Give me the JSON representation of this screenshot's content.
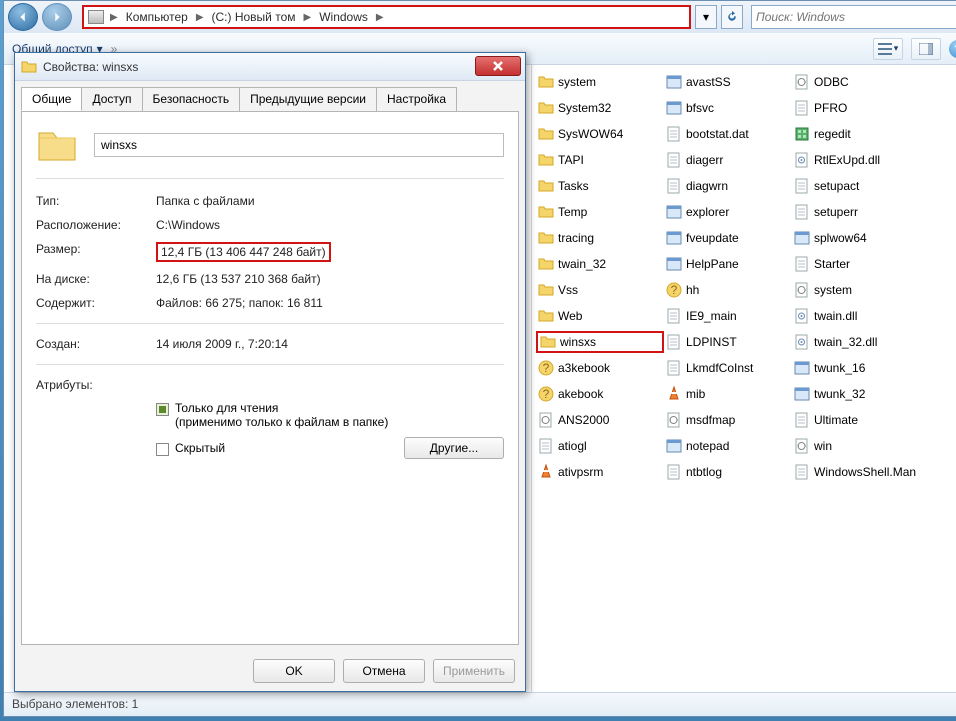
{
  "explorer": {
    "breadcrumbs": [
      "Компьютер",
      "(C:) Новый том",
      "Windows"
    ],
    "search_placeholder": "Поиск: Windows",
    "toolbar": {
      "share": "Общий доступ",
      "more": "»"
    },
    "statusbar": "Выбрано элементов: 1"
  },
  "files": {
    "col1": [
      {
        "n": "system",
        "t": "folder"
      },
      {
        "n": "System32",
        "t": "folder"
      },
      {
        "n": "SysWOW64",
        "t": "folder"
      },
      {
        "n": "TAPI",
        "t": "folder"
      },
      {
        "n": "Tasks",
        "t": "folder"
      },
      {
        "n": "Temp",
        "t": "folder"
      },
      {
        "n": "tracing",
        "t": "folder"
      },
      {
        "n": "twain_32",
        "t": "folder"
      },
      {
        "n": "Vss",
        "t": "folder"
      },
      {
        "n": "Web",
        "t": "folder"
      },
      {
        "n": "winsxs",
        "t": "folder",
        "hl": true
      },
      {
        "n": "a3kebook",
        "t": "hlp"
      },
      {
        "n": "akebook",
        "t": "hlp"
      },
      {
        "n": "ANS2000",
        "t": "cfg"
      },
      {
        "n": "atiogl",
        "t": "file"
      },
      {
        "n": "ativpsrm",
        "t": "vlc"
      }
    ],
    "col2": [
      {
        "n": "avastSS",
        "t": "app"
      },
      {
        "n": "bfsvc",
        "t": "app"
      },
      {
        "n": "bootstat.dat",
        "t": "file"
      },
      {
        "n": "diagerr",
        "t": "file"
      },
      {
        "n": "diagwrn",
        "t": "file"
      },
      {
        "n": "explorer",
        "t": "app"
      },
      {
        "n": "fveupdate",
        "t": "app"
      },
      {
        "n": "HelpPane",
        "t": "app"
      },
      {
        "n": "hh",
        "t": "hlp"
      },
      {
        "n": "IE9_main",
        "t": "file"
      },
      {
        "n": "LDPINST",
        "t": "file"
      },
      {
        "n": "LkmdfCoInst",
        "t": "file"
      },
      {
        "n": "mib",
        "t": "vlc"
      },
      {
        "n": "msdfmap",
        "t": "cfg"
      },
      {
        "n": "notepad",
        "t": "app"
      },
      {
        "n": "ntbtlog",
        "t": "file"
      }
    ],
    "col3": [
      {
        "n": "ODBC",
        "t": "cfg"
      },
      {
        "n": "PFRO",
        "t": "file"
      },
      {
        "n": "regedit",
        "t": "reg"
      },
      {
        "n": "RtlExUpd.dll",
        "t": "dll"
      },
      {
        "n": "setupact",
        "t": "file"
      },
      {
        "n": "setuperr",
        "t": "file"
      },
      {
        "n": "splwow64",
        "t": "app"
      },
      {
        "n": "Starter",
        "t": "file"
      },
      {
        "n": "system",
        "t": "cfg"
      },
      {
        "n": "twain.dll",
        "t": "dll"
      },
      {
        "n": "twain_32.dll",
        "t": "dll"
      },
      {
        "n": "twunk_16",
        "t": "app"
      },
      {
        "n": "twunk_32",
        "t": "app"
      },
      {
        "n": "Ultimate",
        "t": "file"
      },
      {
        "n": "win",
        "t": "cfg"
      },
      {
        "n": "WindowsShell.Man",
        "t": "file"
      }
    ]
  },
  "dialog": {
    "title": "Свойства: winsxs",
    "tabs": [
      "Общие",
      "Доступ",
      "Безопасность",
      "Предыдущие версии",
      "Настройка"
    ],
    "name": "winsxs",
    "rows": {
      "type_l": "Тип:",
      "type_v": "Папка с файлами",
      "loc_l": "Расположение:",
      "loc_v": "C:\\Windows",
      "size_l": "Размер:",
      "size_v": "12,4 ГБ (13 406 447 248 байт)",
      "disk_l": "На диске:",
      "disk_v": "12,6 ГБ (13 537 210 368 байт)",
      "cont_l": "Содержит:",
      "cont_v": "Файлов: 66 275; папок: 16 811",
      "crt_l": "Создан:",
      "crt_v": "14 июля 2009 г., 7:20:14",
      "attr_l": "Атрибуты:"
    },
    "readonly_label": "Только для чтения",
    "readonly_hint": "(применимо только к файлам в папке)",
    "hidden_label": "Скрытый",
    "other_btn": "Другие...",
    "buttons": {
      "ok": "OK",
      "cancel": "Отмена",
      "apply": "Применить"
    }
  }
}
